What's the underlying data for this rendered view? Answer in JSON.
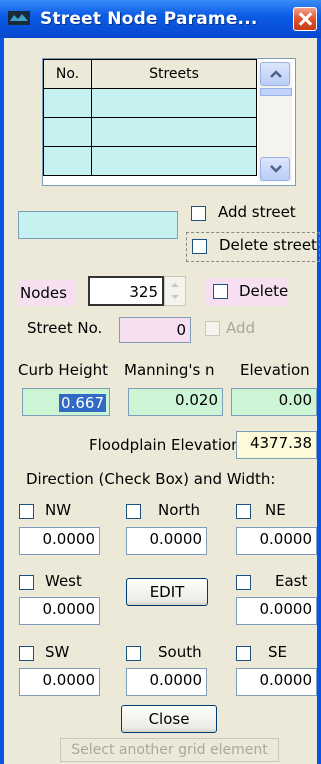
{
  "window": {
    "title": "Street Node Parame..."
  },
  "streets_grid": {
    "columns": [
      "No.",
      "Streets"
    ],
    "rows": [
      [
        "",
        ""
      ],
      [
        "",
        ""
      ],
      [
        "",
        ""
      ]
    ]
  },
  "street_entry": {
    "value": ""
  },
  "add_street": {
    "label": "Add street"
  },
  "delete_street": {
    "label": "Delete street"
  },
  "nodes": {
    "label": "Nodes",
    "value": "325"
  },
  "delete_node": {
    "label": "Delete"
  },
  "street_no": {
    "label": "Street No.",
    "value": "0"
  },
  "add": {
    "label": "Add"
  },
  "curb_height": {
    "label": "Curb Height",
    "value": "0.667"
  },
  "mannings_n": {
    "label": "Manning's n",
    "value": "0.020"
  },
  "elevation": {
    "label": "Elevation",
    "value": "0.00"
  },
  "floodplain": {
    "label": "Floodplain Elevation:",
    "value": "4377.38"
  },
  "direction_heading": "Direction (Check Box) and Width:",
  "directions": {
    "nw": {
      "label": "NW",
      "value": "0.0000"
    },
    "north": {
      "label": "North",
      "value": "0.0000"
    },
    "ne": {
      "label": "NE",
      "value": "0.0000"
    },
    "west": {
      "label": "West",
      "value": "0.0000"
    },
    "east": {
      "label": "East",
      "value": "0.0000"
    },
    "sw": {
      "label": "SW",
      "value": "0.0000"
    },
    "south": {
      "label": "South",
      "value": "0.0000"
    },
    "se": {
      "label": "SE",
      "value": "0.0000"
    }
  },
  "edit_button": "EDIT",
  "close_button": "Close",
  "status_text": "Select another grid element",
  "colors": {
    "titlebar": "#0b5ce6",
    "grid_cell": "#c6f1f1",
    "pink": "#f5dff0",
    "green": "#ccf5d6",
    "yellow": "#fcfad8",
    "panel": "#ece9d8"
  }
}
